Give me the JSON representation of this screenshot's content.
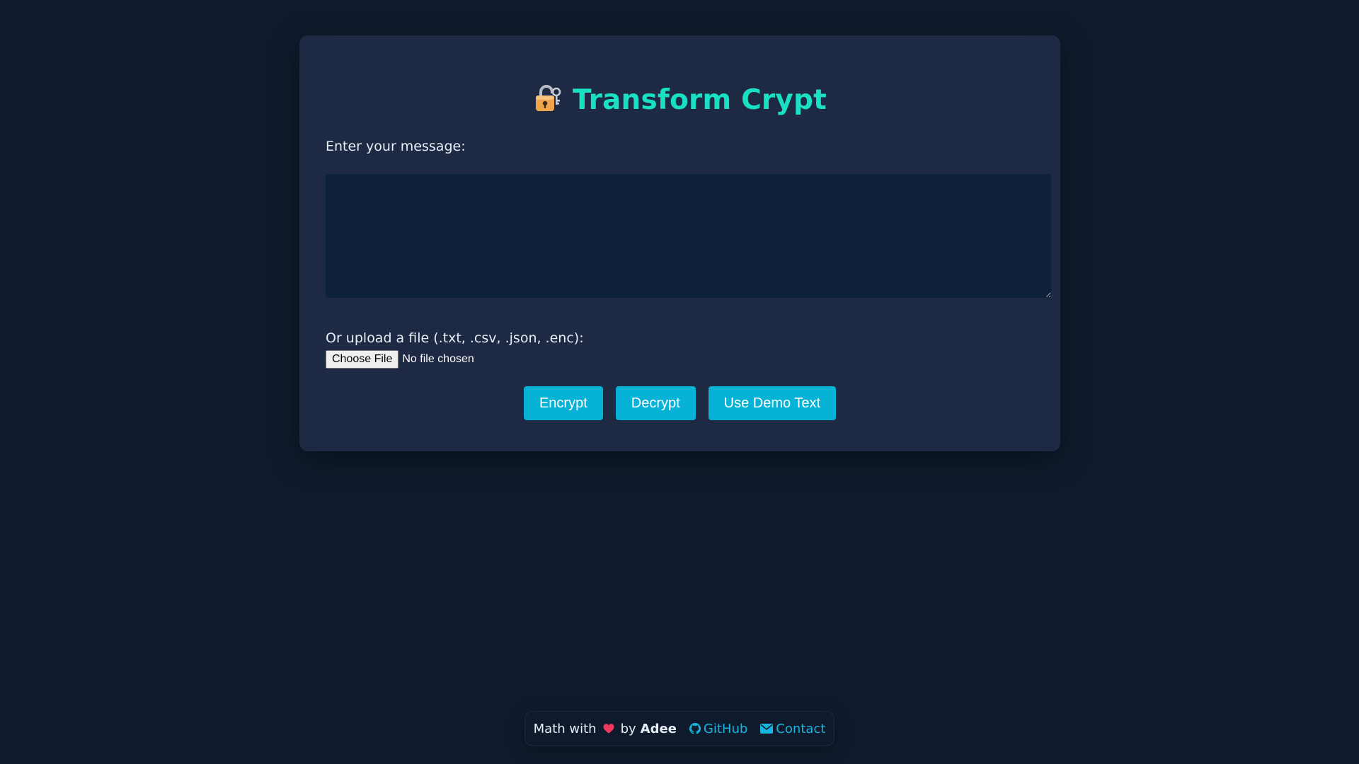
{
  "app": {
    "title": "Transform Crypt",
    "title_icon": "lock-with-key-icon"
  },
  "message": {
    "label": "Enter your message:",
    "value": "",
    "placeholder": ""
  },
  "file_upload": {
    "label": "Or upload a file (.txt, .csv, .json, .enc):",
    "button_label": "Choose File",
    "status": "No file chosen"
  },
  "actions": {
    "encrypt_label": "Encrypt",
    "decrypt_label": "Decrypt",
    "demo_label": "Use Demo Text"
  },
  "footer": {
    "prefix": "Math with",
    "by": "by",
    "author": "Adee",
    "github_label": "GitHub",
    "contact_label": "Contact"
  },
  "colors": {
    "background": "#0f1b2d",
    "card": "#1e2a44",
    "accent_title": "#19e0c2",
    "button": "#06b2d6",
    "link": "#17b5de",
    "heart": "#f0395f"
  }
}
